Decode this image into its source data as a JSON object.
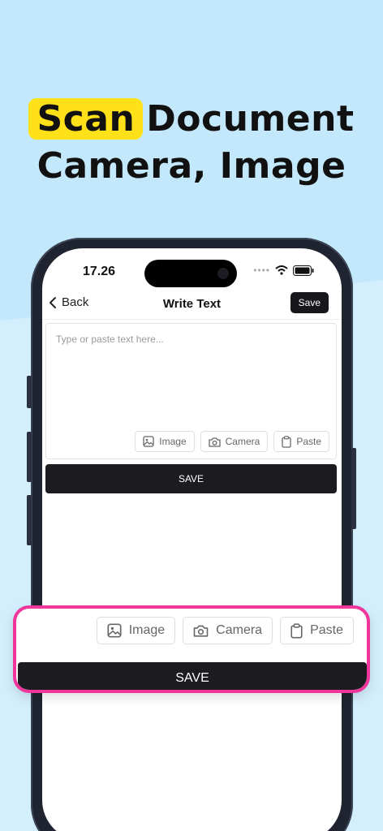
{
  "headline": {
    "highlight": "Scan",
    "rest_line1": "Document",
    "line2": "Camera, Image"
  },
  "status_bar": {
    "time": "17.26",
    "dots": "••••"
  },
  "nav": {
    "back_label": "Back",
    "title": "Write Text",
    "save_label": "Save"
  },
  "editor": {
    "placeholder": "Type or paste text here...",
    "tools": [
      {
        "label": "Image",
        "icon": "image-icon"
      },
      {
        "label": "Camera",
        "icon": "camera-icon"
      },
      {
        "label": "Paste",
        "icon": "clipboard-icon"
      }
    ]
  },
  "save_button": {
    "label": "SAVE"
  },
  "callout": {
    "tools": [
      {
        "label": "Image",
        "icon": "image-icon"
      },
      {
        "label": "Camera",
        "icon": "camera-icon"
      },
      {
        "label": "Paste",
        "icon": "clipboard-icon"
      }
    ],
    "save_label": "SAVE"
  },
  "colors": {
    "background": "#c3e8fb",
    "highlight": "#ffe11a",
    "callout_border": "#f0359b",
    "button_dark": "#1b1b20"
  }
}
